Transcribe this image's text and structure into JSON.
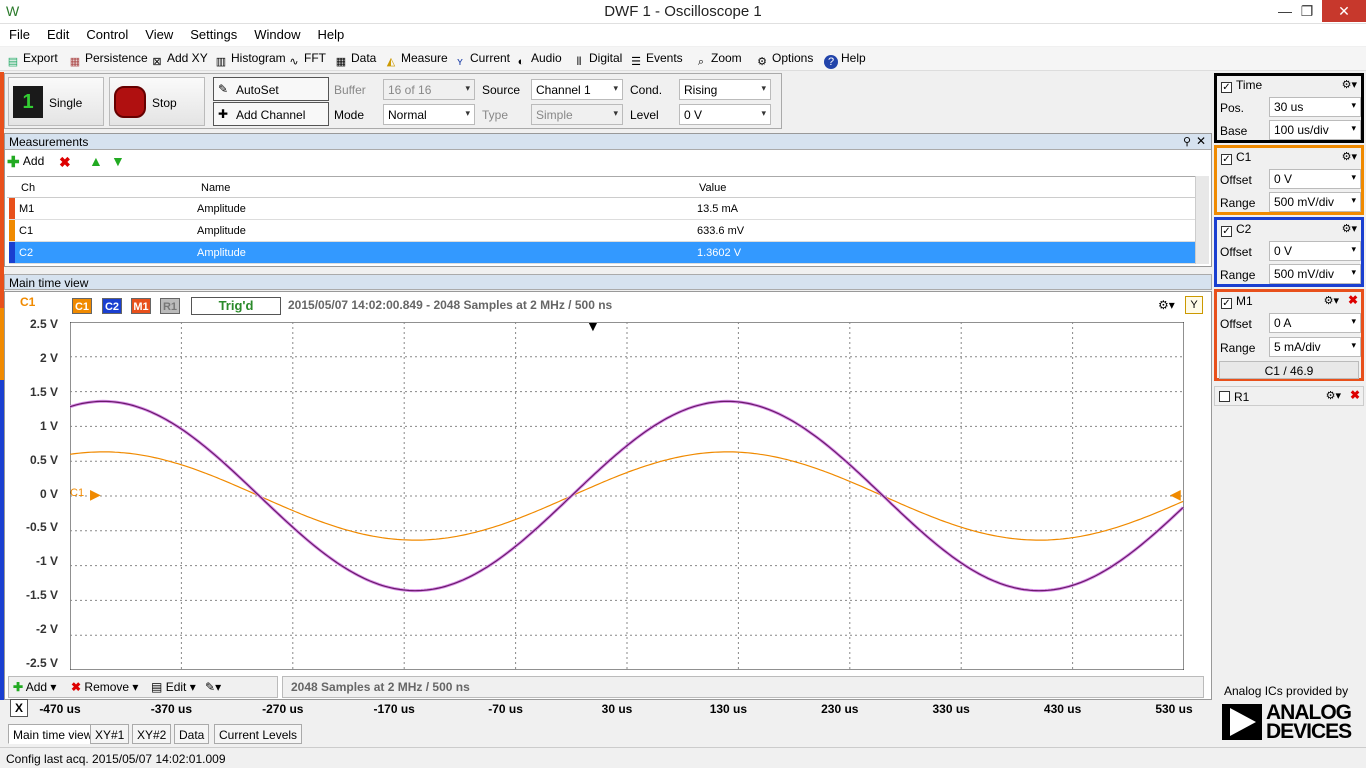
{
  "window": {
    "title": "DWF 1 - Oscilloscope 1",
    "min": "—",
    "max": "❐",
    "close": "✕"
  },
  "menu": [
    "File",
    "Edit",
    "Control",
    "View",
    "Settings",
    "Window",
    "Help"
  ],
  "toolbar": [
    "Export",
    "Persistence",
    "Add XY",
    "Histogram",
    "FFT",
    "Data",
    "Measure",
    "Current",
    "Audio",
    "Digital",
    "Events",
    "Zoom",
    "Options",
    "Help"
  ],
  "control": {
    "single": "Single",
    "stop": "Stop",
    "autoset": "AutoSet",
    "add_channel": "Add Channel",
    "buffer_label": "Buffer",
    "buffer_value": "16 of 16",
    "mode_label": "Mode",
    "mode_value": "Normal",
    "source_label": "Source",
    "source_value": "Channel 1",
    "type_label": "Type",
    "type_value": "Simple",
    "cond_label": "Cond.",
    "cond_value": "Rising",
    "level_label": "Level",
    "level_value": "0 V"
  },
  "measurements": {
    "title": "Measurements",
    "add": "Add",
    "headers": [
      "Ch",
      "Name",
      "Value"
    ],
    "rows": [
      {
        "ch": "M1",
        "name": "Amplitude",
        "value": "13.5 mA",
        "color": "#e8501b"
      },
      {
        "ch": "C1",
        "name": "Amplitude",
        "value": "633.6 mV",
        "color": "#f08a00"
      },
      {
        "ch": "C2",
        "name": "Amplitude",
        "value": "1.3602 V",
        "color": "#1a3fd0"
      }
    ]
  },
  "timeview": {
    "title": "Main time view",
    "axis_ch": "C1",
    "badges": [
      "C1",
      "C2",
      "M1",
      "R1"
    ],
    "trig": "Trig'd",
    "info": "2015/05/07  14:02:00.849 - 2048 Samples at 2 MHz / 500 ns",
    "samples": "2048 Samples at 2 MHz / 500 ns",
    "marker": "C1",
    "yticks": [
      "2.5 V",
      "2 V",
      "1.5 V",
      "1 V",
      "0.5 V",
      "0 V",
      "-0.5 V",
      "-1 V",
      "-1.5 V",
      "-2 V",
      "-2.5 V"
    ],
    "xticks": [
      "-470 us",
      "-370 us",
      "-270 us",
      "-170 us",
      "-70 us",
      "30 us",
      "130 us",
      "230 us",
      "330 us",
      "430 us",
      "530 us"
    ],
    "x_label": "X"
  },
  "bottom": {
    "add": "Add",
    "remove": "Remove",
    "edit": "Edit"
  },
  "tabs": [
    "Main time view",
    "XY#1",
    "XY#2",
    "Data",
    "Current Levels"
  ],
  "status": "Config last acq. 2015/05/07  14:02:01.009",
  "side": {
    "time": {
      "title": "Time",
      "pos_label": "Pos.",
      "pos": "30 us",
      "base_label": "Base",
      "base": "100 us/div"
    },
    "c1": {
      "title": "C1",
      "offset_label": "Offset",
      "offset": "0 V",
      "range_label": "Range",
      "range": "500 mV/div"
    },
    "c2": {
      "title": "C2",
      "offset_label": "Offset",
      "offset": "0 V",
      "range_label": "Range",
      "range": "500 mV/div"
    },
    "m1": {
      "title": "M1",
      "offset_label": "Offset",
      "offset": "0 A",
      "range_label": "Range",
      "range": "5 mA/div",
      "formula": "C1 / 46.9"
    },
    "r1": {
      "title": "R1"
    }
  },
  "brand": {
    "provided": "Analog ICs provided by",
    "line1": "ANALOG",
    "line2": "DEVICES"
  },
  "colors": {
    "c1": "#f08a00",
    "c2": "#1a3fd0",
    "m1": "#e8501b",
    "sel": "#3399ff"
  }
}
